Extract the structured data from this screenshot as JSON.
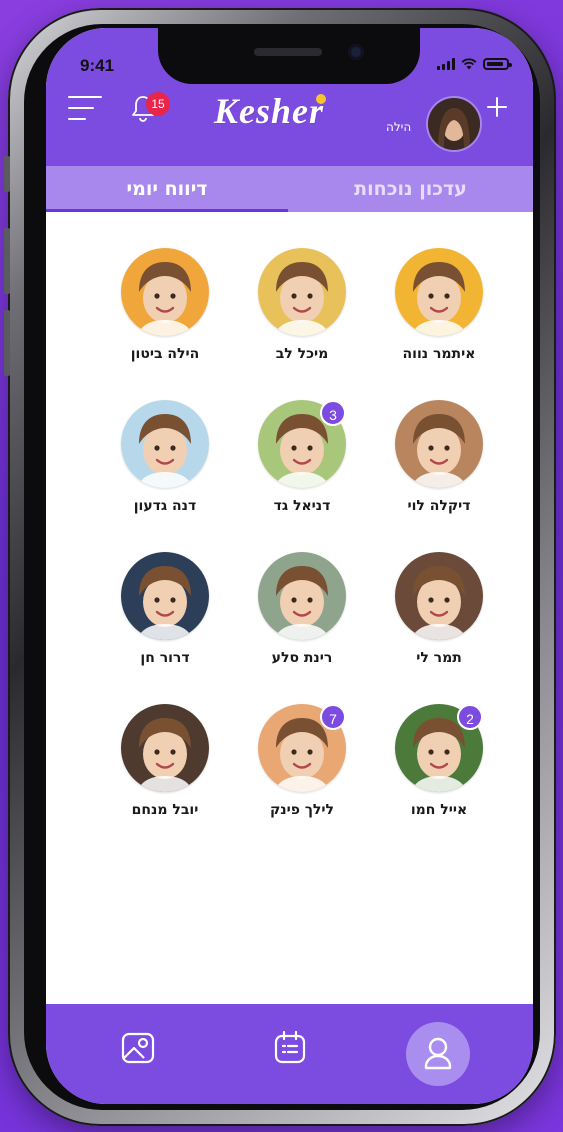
{
  "status_bar": {
    "time": "9:41"
  },
  "header": {
    "notifications_count": "15",
    "logo": "Kesher",
    "user_name": "הילה"
  },
  "tabs": [
    {
      "label": "עדכון נוכחות",
      "active": false
    },
    {
      "label": "דיווח יומי",
      "active": true
    }
  ],
  "children": [
    {
      "name": "איתמר נווה",
      "badge": null,
      "photo_bg": "#f2b533"
    },
    {
      "name": "מיכל לב",
      "badge": null,
      "photo_bg": "#e8c15a"
    },
    {
      "name": "הילה ביטון",
      "badge": null,
      "photo_bg": "#f0a63a"
    },
    {
      "name": "דיקלה לוי",
      "badge": null,
      "photo_bg": "#b9855f"
    },
    {
      "name": "דניאל גד",
      "badge": "3",
      "photo_bg": "#a9c77a"
    },
    {
      "name": "דנה גדעון",
      "badge": null,
      "photo_bg": "#b7d8ea"
    },
    {
      "name": "תמר לי",
      "badge": null,
      "photo_bg": "#6b4a3a"
    },
    {
      "name": "רינת סלע",
      "badge": null,
      "photo_bg": "#8fa48c"
    },
    {
      "name": "דרור חן",
      "badge": null,
      "photo_bg": "#2c3e58"
    },
    {
      "name": "אייל חמו",
      "badge": "2",
      "photo_bg": "#4c7a3a"
    },
    {
      "name": "לילך פינק",
      "badge": "7",
      "photo_bg": "#e9a774"
    },
    {
      "name": "יובל מנחם",
      "badge": null,
      "photo_bg": "#4e3a2e"
    }
  ],
  "bottom_nav": [
    {
      "icon": "gallery-icon"
    },
    {
      "icon": "calendar-icon"
    },
    {
      "icon": "profile-icon",
      "active": true
    }
  ],
  "colors": {
    "primary": "#7c4be0",
    "tab_bg": "#a988ee",
    "badge_red": "#e8254b",
    "nav_active": "#a98ef0"
  }
}
